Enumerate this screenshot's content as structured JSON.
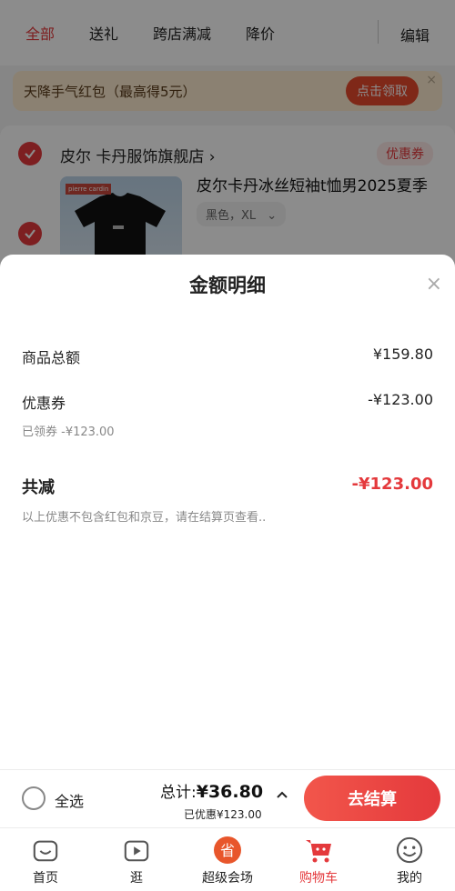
{
  "tabs": [
    "全部",
    "送礼",
    "跨店满减",
    "降价"
  ],
  "edit_label": "编辑",
  "promo": {
    "text": "天降手气红包（最高得5元）",
    "button": "点击领取",
    "close": "×"
  },
  "store": {
    "name": "皮尔 卡丹服饰旗舰店 ›",
    "coupon_tag": "优惠券",
    "product_title": "皮尔卡丹冰丝短袖t恤男2025夏季",
    "variant": "黑色，XL",
    "variant_chevron": "⌄",
    "image_brand": "pierre cardin"
  },
  "sheet": {
    "title": "金额明细",
    "close": "×",
    "goods_label": "商品总额",
    "goods_value": "¥159.80",
    "coupon_label": "优惠券",
    "coupon_value": "-¥123.00",
    "coupon_sub": "已领券 -¥123.00",
    "total_label": "共减",
    "total_value": "-¥123.00",
    "note": "以上优惠不包含红包和京豆，请在结算页查看.."
  },
  "checkout": {
    "select_all": "全选",
    "total_prefix": "总计:",
    "total_amount": "¥36.80",
    "saved": "已优惠¥123.00",
    "button": "去结算"
  },
  "nav": {
    "items": [
      {
        "label": "首页",
        "icon": "home-icon"
      },
      {
        "label": "逛",
        "icon": "play-icon"
      },
      {
        "label": "超级会场",
        "icon": "super-venue-icon"
      },
      {
        "label": "购物车",
        "icon": "cart-icon"
      },
      {
        "label": "我的",
        "icon": "profile-icon"
      }
    ],
    "active_index": 3
  },
  "colors": {
    "accent": "#e4393c",
    "promo_bg": "#fdeccf"
  }
}
